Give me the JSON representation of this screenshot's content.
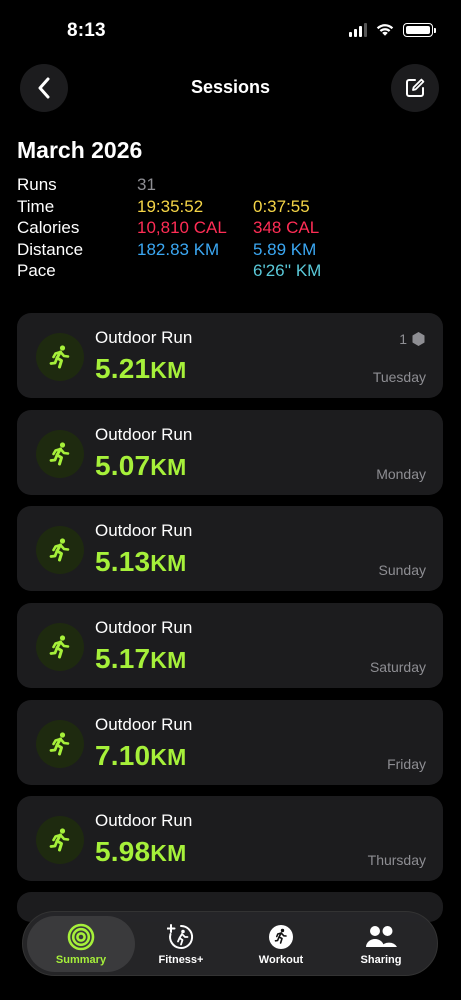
{
  "status_bar": {
    "time": "8:13"
  },
  "header": {
    "title": "Sessions",
    "back_icon": "chevron-left-icon",
    "edit_icon": "compose-icon"
  },
  "summary": {
    "month": "March 2026",
    "rows": [
      {
        "label": "Runs",
        "total": "31",
        "average": "",
        "total_color": "#8e8e93",
        "average_color": "#8e8e93"
      },
      {
        "label": "Time",
        "total": "19:35:52",
        "average": "0:37:55",
        "total_color": "#f5d547",
        "average_color": "#f5d547"
      },
      {
        "label": "Calories",
        "total": "10,810 CAL",
        "average": "348 CAL",
        "total_color": "#ff2d55",
        "average_color": "#ff2d55"
      },
      {
        "label": "Distance",
        "total": "182.83 KM",
        "average": "5.89 KM",
        "total_color": "#3ba7f2",
        "average_color": "#3ba7f2"
      },
      {
        "label": "Pace",
        "total": "",
        "average": "6'26'' KM",
        "total_color": "#5ac8d8",
        "average_color": "#5ac8d8"
      }
    ]
  },
  "sessions": [
    {
      "type": "Outdoor Run",
      "distance": "5.21",
      "unit": "KM",
      "day": "Tuesday",
      "badge_count": "1"
    },
    {
      "type": "Outdoor Run",
      "distance": "5.07",
      "unit": "KM",
      "day": "Monday"
    },
    {
      "type": "Outdoor Run",
      "distance": "5.13",
      "unit": "KM",
      "day": "Sunday"
    },
    {
      "type": "Outdoor Run",
      "distance": "5.17",
      "unit": "KM",
      "day": "Saturday"
    },
    {
      "type": "Outdoor Run",
      "distance": "7.10",
      "unit": "KM",
      "day": "Friday"
    },
    {
      "type": "Outdoor Run",
      "distance": "5.98",
      "unit": "KM",
      "day": "Thursday"
    }
  ],
  "tab_bar": {
    "tabs": [
      {
        "label": "Summary",
        "icon": "activity-rings-icon",
        "active": true
      },
      {
        "label": "Fitness+",
        "icon": "fitness-plus-icon",
        "active": false
      },
      {
        "label": "Workout",
        "icon": "workout-runner-icon",
        "active": false
      },
      {
        "label": "Sharing",
        "icon": "people-icon",
        "active": false
      }
    ]
  },
  "colors": {
    "accent": "#a6f03a",
    "card": "#1c1c1e",
    "muted": "#8e8e93"
  }
}
